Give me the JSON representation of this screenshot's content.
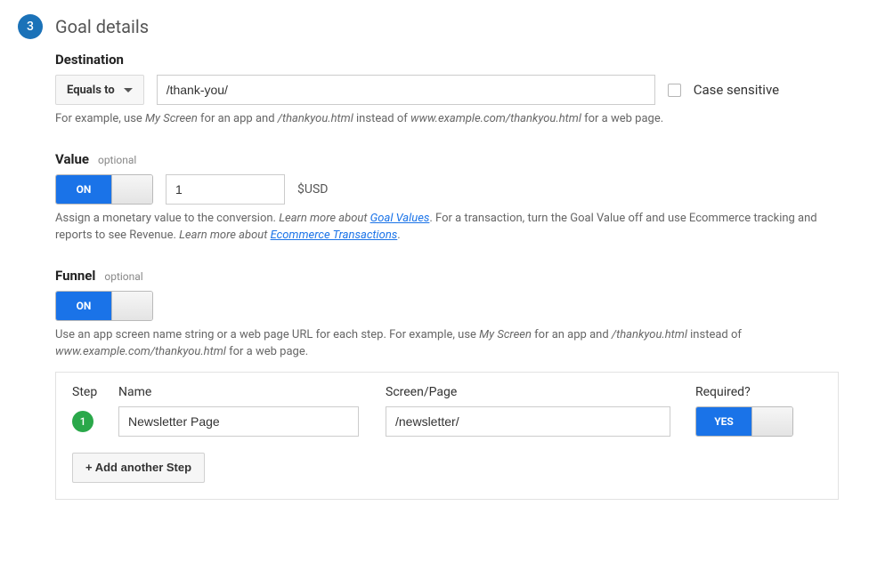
{
  "header": {
    "step_number": "3",
    "title": "Goal details"
  },
  "destination": {
    "label": "Destination",
    "match_type": "Equals to",
    "url": "/thank-you/",
    "case_sensitive_label": "Case sensitive",
    "hint_prefix": "For example, use ",
    "hint_em1": "My Screen",
    "hint_mid1": " for an app and ",
    "hint_em2": "/thankyou.html",
    "hint_mid2": " instead of ",
    "hint_em3": "www.example.com/thankyou.html",
    "hint_suffix": " for a web page."
  },
  "value": {
    "label": "Value",
    "optional": "optional",
    "toggle": "ON",
    "amount": "1",
    "currency": "$USD",
    "hint1": "Assign a monetary value to the conversion. ",
    "hint_em1": "Learn more about ",
    "link1": "Goal Values",
    "hint2": ". For a transaction, turn the Goal Value off and use Ecommerce tracking and reports to see Revenue. ",
    "hint_em2": "Learn more about ",
    "link2": "Ecommerce Transactions",
    "hint3": "."
  },
  "funnel": {
    "label": "Funnel",
    "optional": "optional",
    "toggle": "ON",
    "hint_prefix": "Use an app screen name string or a web page URL for each step. For example, use ",
    "hint_em1": "My Screen",
    "hint_mid1": " for an app and ",
    "hint_em2": "/thankyou.html",
    "hint_mid2": " instead of ",
    "hint_em3": "www.example.com/thankyou.html",
    "hint_suffix": " for a web page.",
    "columns": {
      "step": "Step",
      "name": "Name",
      "page": "Screen/Page",
      "required": "Required?"
    },
    "steps": [
      {
        "num": "1",
        "name": "Newsletter Page",
        "page": "/newsletter/",
        "required": "YES"
      }
    ],
    "add_label": "+ Add another Step"
  }
}
